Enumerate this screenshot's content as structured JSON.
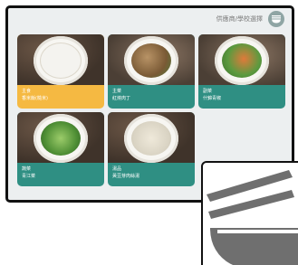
{
  "header": {
    "link_text": "供應商/學校選擇",
    "menu_icon": "bowl-chopsticks-icon"
  },
  "dishes": [
    {
      "category": "主食",
      "name": "香米飯(糙米)",
      "selected": true,
      "food_color": "#f4f3ef"
    },
    {
      "category": "主菜",
      "name": "紅燒肉丁",
      "selected": false,
      "food_color": "#8a6a43"
    },
    {
      "category": "副菜",
      "name": "什錦青椒",
      "selected": false,
      "food_color": "#4c8c3c"
    },
    {
      "category": "蔬菜",
      "name": "青江菜",
      "selected": false,
      "food_color": "#4f8f35"
    },
    {
      "category": "湯品",
      "name": "黃豆芽肉絲湯",
      "selected": false,
      "food_color": "#d8d2c2"
    }
  ],
  "colors": {
    "card_default": "#2f8f83",
    "card_selected": "#f5b942",
    "menu_button": "#8fa5a4",
    "overlay_icon": "#6f6f6f"
  },
  "overlay_icon": "bowl-chopsticks-icon"
}
